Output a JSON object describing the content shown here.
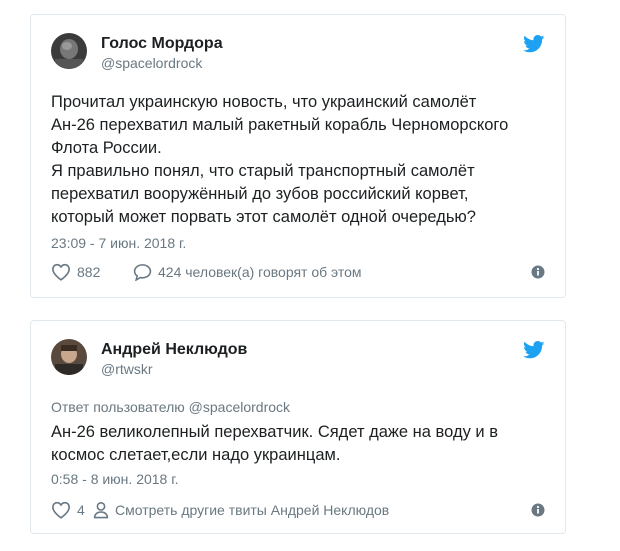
{
  "tweets": [
    {
      "author_name": "Голос Мордора",
      "author_handle": "@spacelordrock",
      "text_lines": [
        "Прочитал украинскую новость, что украинский самолёт",
        "Ан-26 перехватил малый ракетный корабль Черноморского",
        "Флота России.",
        "Я правильно понял, что старый транспортный самолёт",
        "перехватил вооружённый до зубов российский корвет,",
        "который может порвать этот самолёт одной очередью?"
      ],
      "timestamp": "23:09 - 7 июн. 2018 г.",
      "likes": "882",
      "conversation": "424 человек(а) говорят об этом"
    },
    {
      "author_name": "Андрей Неклюдов",
      "author_handle": "@rtwskr",
      "reply_to": "Ответ пользователю @spacelordrock",
      "text_lines": [
        "Ан-26 великолепный перехватчик. Сядет даже на воду и в",
        "космос слетает,если надо украинцам."
      ],
      "timestamp": "0:58 - 8 июн. 2018 г.",
      "likes": "4",
      "more_tweets": "Смотреть другие твиты Андрей Неклюдов"
    }
  ],
  "colors": {
    "twitter_blue": "#1da1f2",
    "border": "#e1e8ed",
    "muted": "#697882",
    "text": "#1c2022"
  },
  "icons": [
    "twitter-bird-icon",
    "heart-icon",
    "speech-bubble-icon",
    "person-icon",
    "info-icon"
  ]
}
